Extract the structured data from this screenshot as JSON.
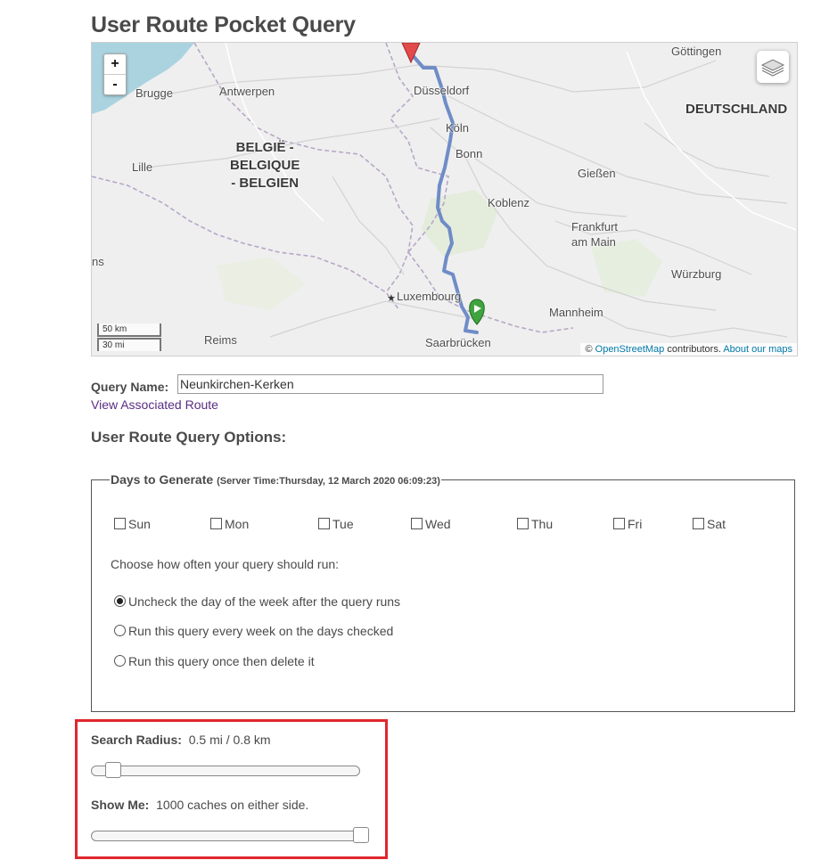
{
  "page": {
    "title": "User Route Pocket Query"
  },
  "map": {
    "zoom_in": "+",
    "zoom_out": "-",
    "scale_km": "50 km",
    "scale_mi": "30 mi",
    "attribution": {
      "prefix": "©",
      "osm_link": "OpenStreetMap",
      "contributors": "contributors.",
      "about_link": "About our maps"
    },
    "labels": {
      "gottingen": "Göttingen",
      "brugge": "Brugge",
      "antwerpen": "Antwerpen",
      "dusseldorf": "Düsseldorf",
      "deutschland": "DEUTSCHLAND",
      "belgie": "BELGIË -\nBELGIQUE\n- BELGIEN",
      "koln": "Köln",
      "bonn": "Bonn",
      "lille": "Lille",
      "giessen": "Gießen",
      "koblenz": "Koblenz",
      "frankfurt": "Frankfurt\nam Main",
      "ns": "ns",
      "wurzburg": "Würzburg",
      "luxembourg": "Luxembourg",
      "mannheim": "Mannheim",
      "reims": "Reims",
      "saarbrucken": "Saarbrücken"
    }
  },
  "query": {
    "name_label": "Query Name:",
    "name_value": "Neunkirchen-Kerken",
    "route_link": "View Associated Route"
  },
  "options": {
    "heading": "User Route Query Options:",
    "days_legend": "Days to Generate",
    "server_time": "(Server Time:Thursday, 12 March 2020 06:09:23)",
    "days": [
      "Sun",
      "Mon",
      "Tue",
      "Wed",
      "Thu",
      "Fri",
      "Sat"
    ],
    "choose_text": "Choose how often your query should run:",
    "run_options": [
      "Uncheck the day of the week after the query runs",
      "Run this query every week on the days checked",
      "Run this query once then delete it"
    ],
    "selected_run_option": 0
  },
  "sliders": {
    "radius_label": "Search Radius:",
    "radius_value": "0.5 mi / 0.8 km",
    "radius_fraction": 0.04,
    "showme_label": "Show Me:",
    "showme_value": "1000 caches on either side.",
    "showme_fraction": 1.0
  },
  "colors": {
    "highlight": "#e0262e",
    "route": "#6f8cc7",
    "link": "#5a2d82"
  }
}
